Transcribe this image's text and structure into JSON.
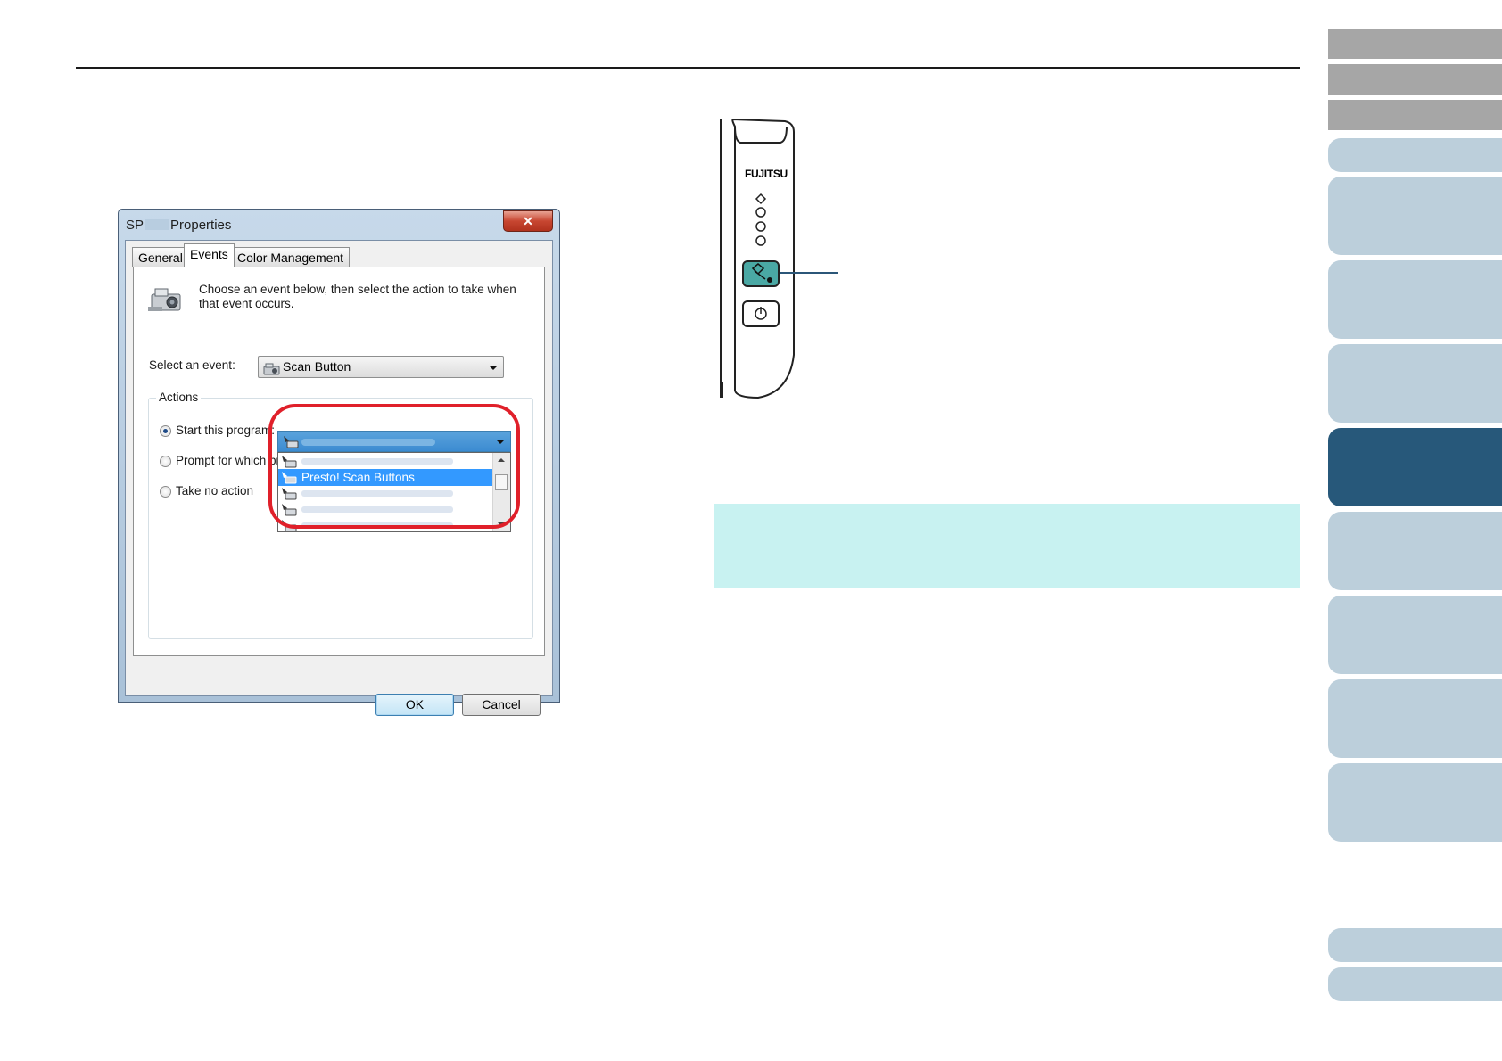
{
  "dialog": {
    "title_prefix": "SP",
    "title_suffix": "Properties",
    "close_label": "✕",
    "tabs": [
      {
        "label": "General"
      },
      {
        "label": "Events"
      },
      {
        "label": "Color Management"
      }
    ],
    "active_tab": "Events",
    "intro": "Choose an event below, then select the action to take when that event occurs.",
    "select_event_label": "Select an event:",
    "event_value": "Scan Button",
    "actions": {
      "legend": "Actions",
      "start_program_label": "Start this program:",
      "prompt_label": "Prompt for which prog",
      "no_action_label": "Take no action",
      "selected": "Start this program:"
    },
    "program_dropdown": {
      "selected_item": "Presto! Scan Buttons"
    },
    "ok_label": "OK",
    "cancel_label": "Cancel"
  },
  "scanner": {
    "brand": "FUJITSU",
    "buttons": [
      "scan-button",
      "power-button"
    ]
  },
  "colors": {
    "nav_active": "#27587a",
    "nav_inactive": "#bccfdb",
    "nav_gray": "#a6a6a6",
    "highlight": "#e0202a",
    "note_bg": "#c8f2f1",
    "selection": "#3399ff"
  }
}
